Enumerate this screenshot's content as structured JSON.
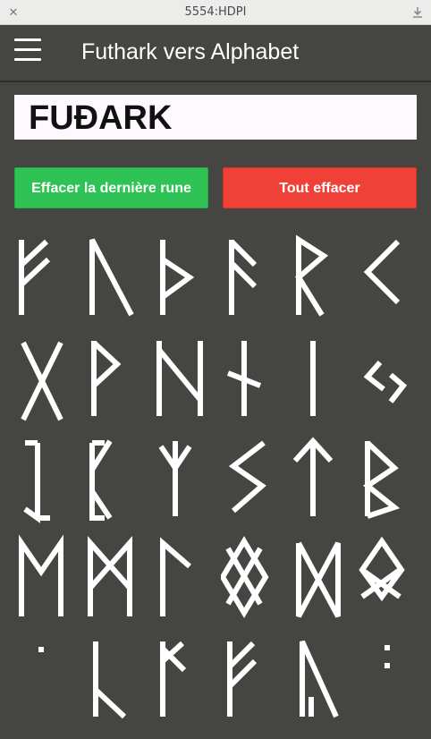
{
  "window": {
    "title": "5554:HDPI",
    "close_icon": "✕"
  },
  "appbar": {
    "title": "Futhark vers Alphabet",
    "menu_icon": "hamburger-menu-icon"
  },
  "display": {
    "value": "FUÐARK"
  },
  "buttons": {
    "clear_last": "Effacer la dernière rune",
    "clear_all": "Tout effacer"
  },
  "colors": {
    "background": "#454542",
    "green": "#2fc254",
    "red": "#ef4137",
    "rune": "#ffffff"
  },
  "runes": [
    "fehu",
    "uruz",
    "thurisaz",
    "ansuz",
    "raido",
    "kaunan",
    "gebo",
    "wunjo",
    "hagalaz",
    "naudiz",
    "isaz",
    "jera",
    "eihwaz",
    "pertho",
    "algiz",
    "sowilo",
    "tiwaz",
    "berkanan",
    "ehwaz",
    "mannaz",
    "laguz",
    "ingwaz",
    "dagaz",
    "othala",
    "dot",
    "laukaz-long",
    "long-branch",
    "long-f",
    "long-a",
    "colon"
  ]
}
